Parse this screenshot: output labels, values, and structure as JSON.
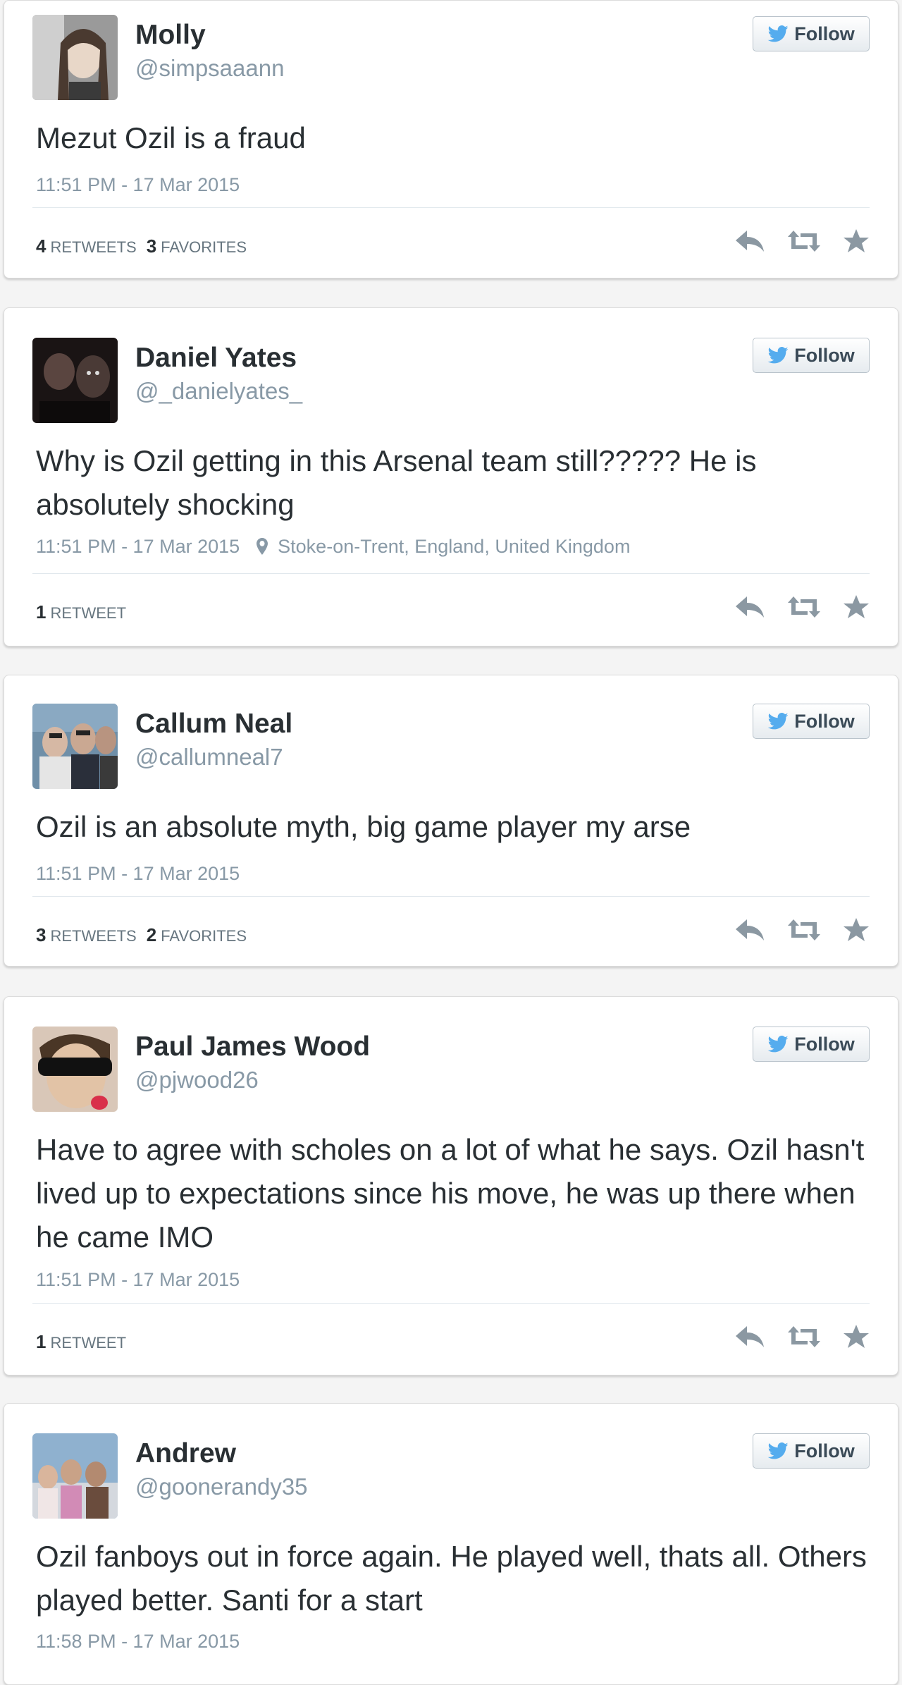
{
  "colors": {
    "name": "#292f33",
    "muted": "#8899a6",
    "bird": "#55acee",
    "icon": "#8b98a2"
  },
  "follow_label": "Follow",
  "tweets": [
    {
      "name": "Molly",
      "handle": "@simpsaaann",
      "text": "Mezut Ozil is a fraud",
      "time": "11:51 PM - 17 Mar 2015",
      "location": "",
      "retweets_count": "4",
      "retweets_label": "RETWEETS",
      "favorites_count": "3",
      "favorites_label": "FAVORITES"
    },
    {
      "name": "Daniel Yates",
      "handle": "@_danielyates_",
      "text": "Why is Ozil getting in this Arsenal team still????? He is absolutely shocking",
      "time": "11:51 PM - 17 Mar 2015",
      "location": "Stoke-on-Trent, England, United Kingdom",
      "retweets_count": "1",
      "retweets_label": "RETWEET",
      "favorites_count": "",
      "favorites_label": ""
    },
    {
      "name": "Callum Neal",
      "handle": "@callumneal7",
      "text": "Ozil is an absolute myth, big game player my arse",
      "time": "11:51 PM - 17 Mar 2015",
      "location": "",
      "retweets_count": "3",
      "retweets_label": "RETWEETS",
      "favorites_count": "2",
      "favorites_label": "FAVORITES"
    },
    {
      "name": "Paul James Wood",
      "handle": "@pjwood26",
      "text": "Have to agree with scholes on a lot of what he says. Ozil hasn't lived up to expectations since his move, he was up there when he came IMO",
      "time": "11:51 PM - 17 Mar 2015",
      "location": "",
      "retweets_count": "1",
      "retweets_label": "RETWEET",
      "favorites_count": "",
      "favorites_label": ""
    },
    {
      "name": "Andrew",
      "handle": "@goonerandy35",
      "text": "Ozil fanboys out in force again. He played well, thats all. Others played better. Santi for a start",
      "time": "11:58 PM - 17 Mar 2015",
      "location": "",
      "retweets_count": "",
      "retweets_label": "",
      "favorites_count": "",
      "favorites_label": ""
    }
  ]
}
